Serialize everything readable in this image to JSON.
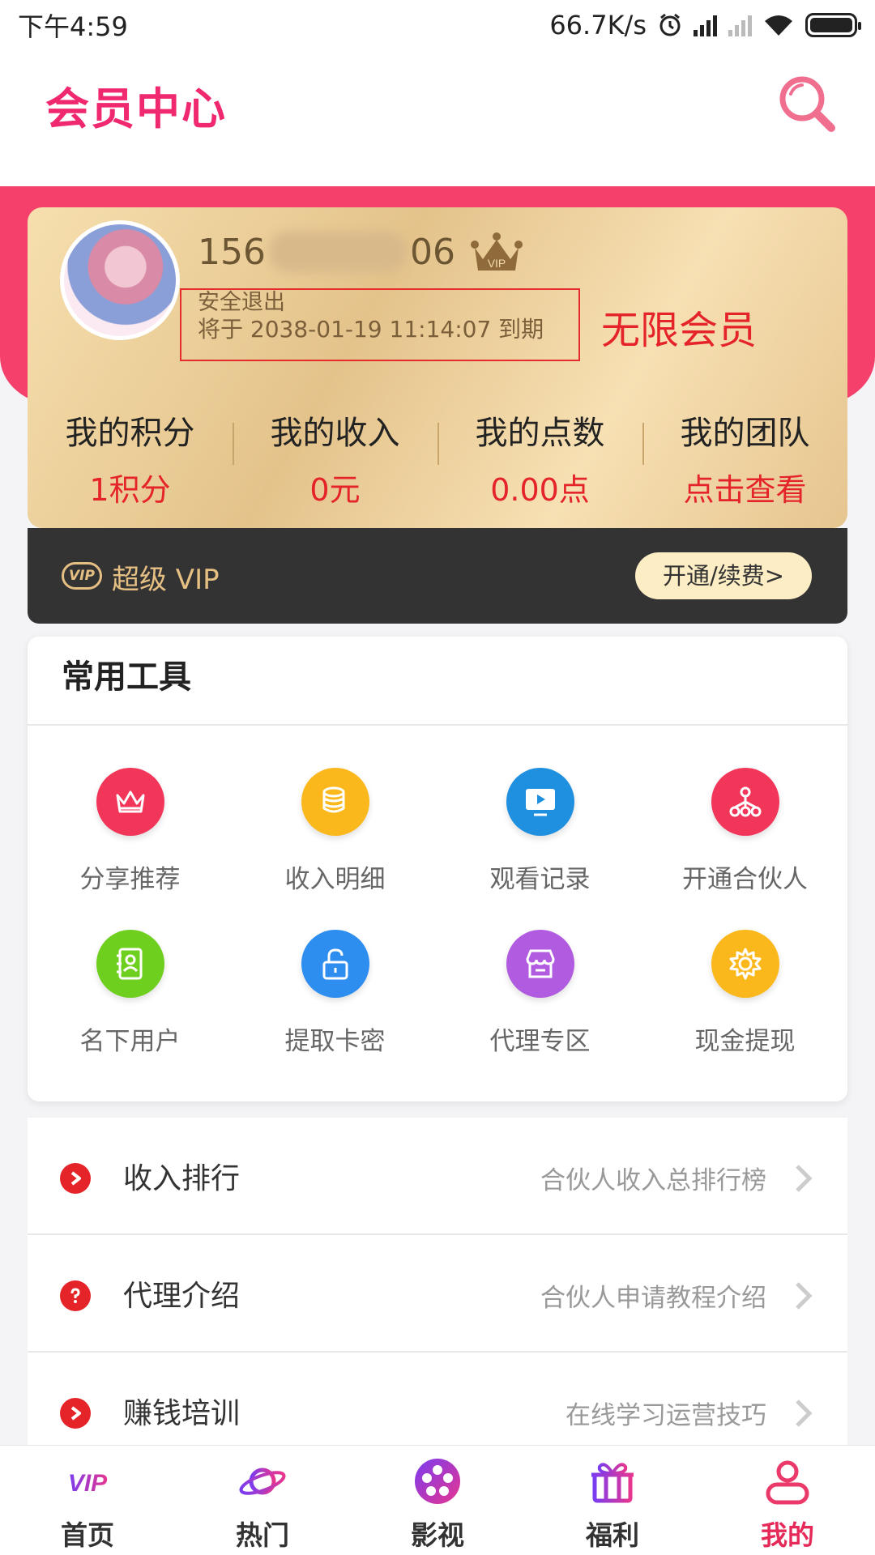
{
  "status": {
    "time": "下午4:59",
    "speed": "66.7K/s"
  },
  "header": {
    "title": "会员中心"
  },
  "profile": {
    "phone_prefix": "156",
    "phone_suffix": "06",
    "vip_badge": "VIP",
    "logout": "安全退出",
    "expiry": "将于 2038-01-19 11:14:07 到期",
    "membership": "无限会员"
  },
  "stats": [
    {
      "label": "我的积分",
      "value": "1积分"
    },
    {
      "label": "我的收入",
      "value": "0元"
    },
    {
      "label": "我的点数",
      "value": "0.00点"
    },
    {
      "label": "我的团队",
      "value": "点击查看"
    }
  ],
  "vip_bar": {
    "badge": "VIP",
    "label": "超级 VIP",
    "button": "开通/续费>"
  },
  "tools": {
    "title": "常用工具",
    "items": [
      {
        "label": "分享推荐",
        "icon": "crown-icon",
        "color": "#f2365a"
      },
      {
        "label": "收入明细",
        "icon": "coins-icon",
        "color": "#fbb81d"
      },
      {
        "label": "观看记录",
        "icon": "screen-play-icon",
        "color": "#1f8fe0"
      },
      {
        "label": "开通合伙人",
        "icon": "hierarchy-icon",
        "color": "#f2365a"
      },
      {
        "label": "名下用户",
        "icon": "contacts-book-icon",
        "color": "#6fcf1e"
      },
      {
        "label": "提取卡密",
        "icon": "unlock-icon",
        "color": "#2d8ef0"
      },
      {
        "label": "代理专区",
        "icon": "store-icon",
        "color": "#b05be0"
      },
      {
        "label": "现金提现",
        "icon": "gear-icon",
        "color": "#fbb81d"
      }
    ]
  },
  "list": [
    {
      "title": "收入排行",
      "subtitle": "合伙人收入总排行榜",
      "icon": "play-arrow-icon"
    },
    {
      "title": "代理介绍",
      "subtitle": "合伙人申请教程介绍",
      "icon": "question-icon"
    },
    {
      "title": "赚钱培训",
      "subtitle": "在线学习运营技巧",
      "icon": "play-arrow-icon"
    }
  ],
  "tabs": [
    {
      "label": "首页",
      "icon": "vip-logo-icon"
    },
    {
      "label": "热门",
      "icon": "planet-icon"
    },
    {
      "label": "影视",
      "icon": "film-reel-icon"
    },
    {
      "label": "福利",
      "icon": "gift-icon"
    },
    {
      "label": "我的",
      "icon": "user-icon"
    }
  ],
  "colors": {
    "brand": "#f0286f",
    "accent_red": "#e5242a",
    "gold": "#e6bf83"
  }
}
